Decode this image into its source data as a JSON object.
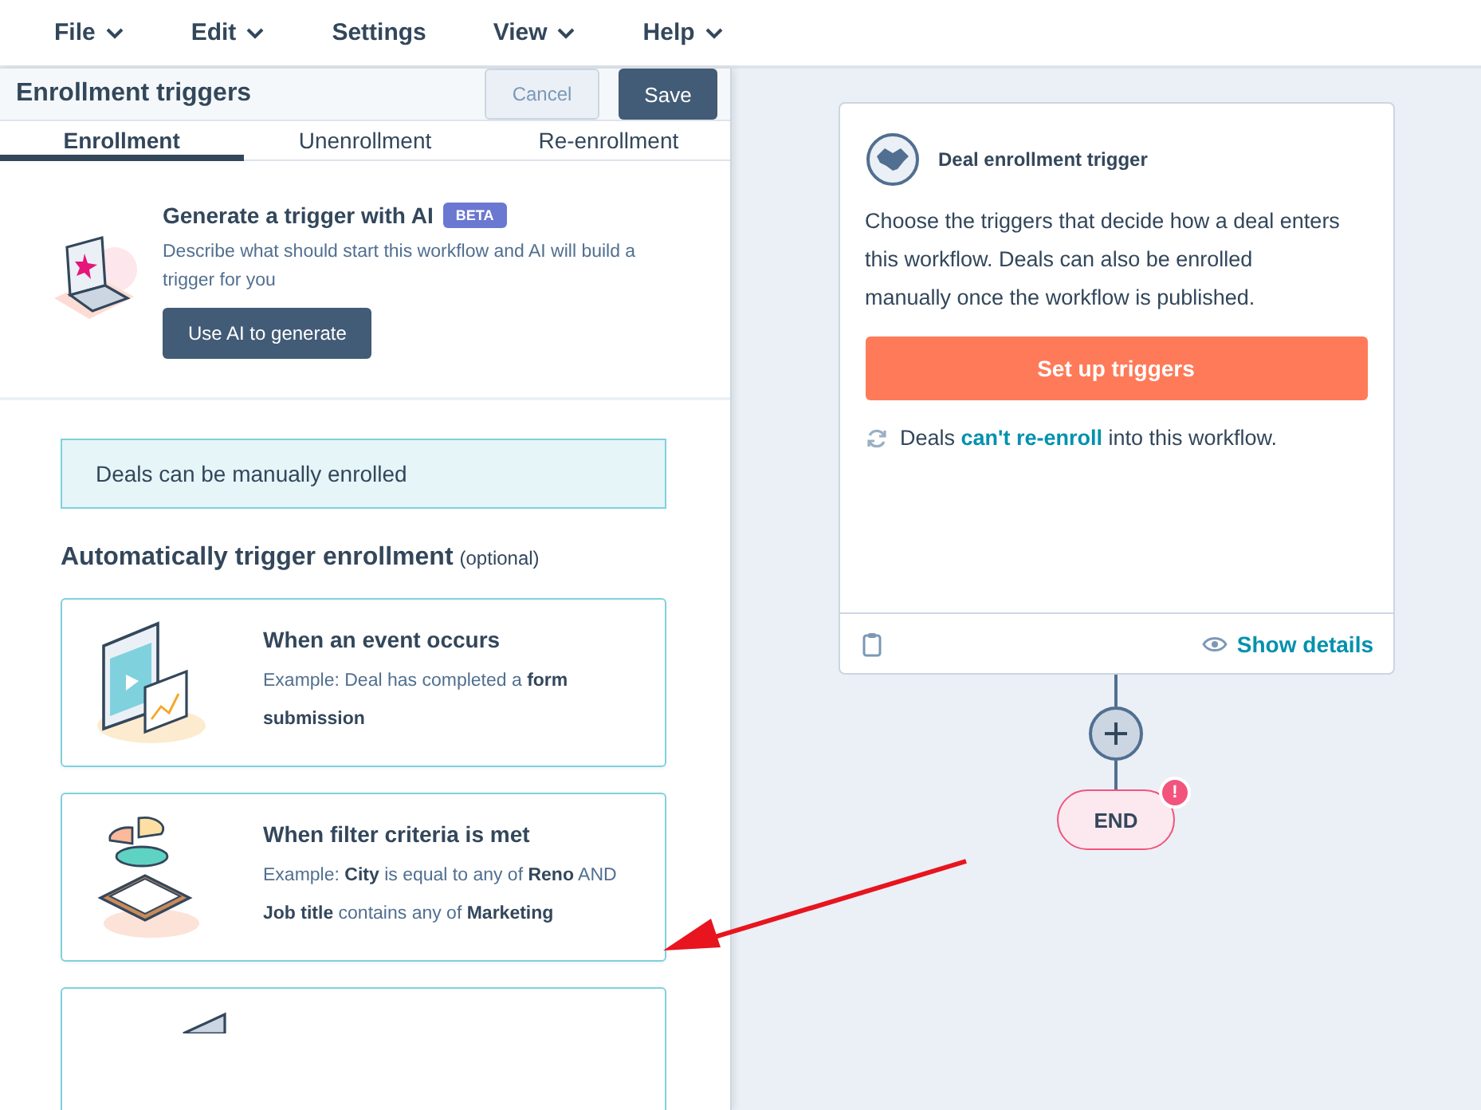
{
  "menu": [
    {
      "label": "File",
      "has_menu": true
    },
    {
      "label": "Edit",
      "has_menu": true
    },
    {
      "label": "Settings",
      "has_menu": false
    },
    {
      "label": "View",
      "has_menu": true
    },
    {
      "label": "Help",
      "has_menu": true
    }
  ],
  "panel": {
    "title": "Enrollment triggers",
    "cancel": "Cancel",
    "save": "Save",
    "tabs": [
      {
        "label": "Enrollment",
        "selected": true
      },
      {
        "label": "Unenrollment",
        "selected": false
      },
      {
        "label": "Re-enrollment",
        "selected": false
      }
    ],
    "ai": {
      "title": "Generate a trigger with AI",
      "badge": "BETA",
      "description": "Describe what should start this workflow and AI will build a trigger for you",
      "button": "Use AI to generate"
    },
    "manual_note": "Deals can be manually enrolled",
    "section_title": "Automatically trigger enrollment",
    "section_note": "(optional)",
    "options": [
      {
        "kind": "event",
        "title": "When an event occurs",
        "example": "Example: Deal has completed a **form submission**"
      },
      {
        "kind": "filter",
        "title": "When filter criteria is met",
        "example": "Example: **City** is equal to any of **Reno** AND **Job title** contains any of **Marketing**"
      },
      {
        "kind": "partial"
      }
    ]
  },
  "canvas": {
    "trigger_card": {
      "title": "Deal enrollment trigger",
      "description": "Choose the triggers that decide how a deal enters this workflow. Deals can also be enrolled manually once the workflow is published.",
      "button": "Set up triggers",
      "reenroll_before": "Deals",
      "reenroll_link": "can't re-enroll",
      "reenroll_after": "into this workflow.",
      "details_link": "Show details"
    },
    "end_node": {
      "label": "END",
      "badge": "!"
    }
  }
}
